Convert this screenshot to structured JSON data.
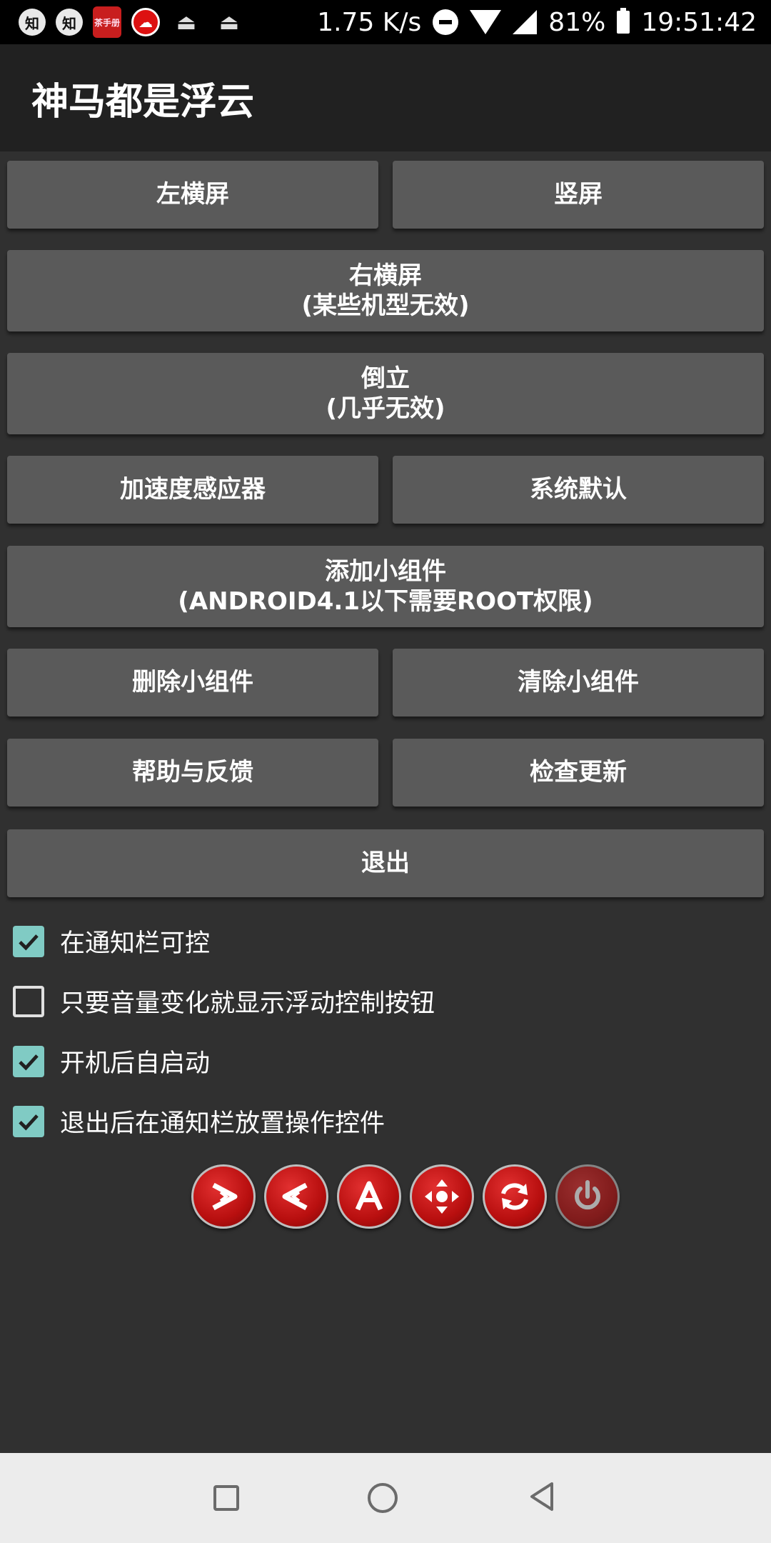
{
  "status_bar": {
    "icons": [
      "zhihu-icon",
      "zhihu-icon",
      "seal-app-icon",
      "cloud-icon",
      "upload-icon",
      "upload-icon"
    ],
    "zhihu1": "知",
    "zhihu2": "知",
    "seal": "茶手册",
    "speed": "1.75 K/s",
    "battery": "81%",
    "time": "19:51:42"
  },
  "app_bar": {
    "title": "神马都是浮云"
  },
  "buttons": {
    "left_landscape": "左横屏",
    "portrait": "竖屏",
    "right_landscape": "右横屏",
    "right_landscape_note": "(某些机型无效)",
    "upside_down": "倒立",
    "upside_down_note": "(几乎无效)",
    "accelerometer": "加速度感应器",
    "system_default": "系统默认",
    "add_widget": "添加小组件",
    "add_widget_note": "(ANDROID4.1以下需要ROOT权限)",
    "delete_widget": "删除小组件",
    "clear_widget": "清除小组件",
    "help_feedback": "帮助与反馈",
    "check_update": "检查更新",
    "exit": "退出"
  },
  "checkboxes": [
    {
      "label": "在通知栏可控",
      "checked": true
    },
    {
      "label": "只要音量变化就显示浮动控制按钮",
      "checked": false
    },
    {
      "label": "开机后自启动",
      "checked": true
    },
    {
      "label": "退出后在通知栏放置操作控件",
      "checked": true
    }
  ],
  "round_buttons": [
    "rotate-left-icon",
    "rotate-right-icon",
    "auto-rotate-icon",
    "move-icon",
    "refresh-icon",
    "power-icon"
  ],
  "colors": {
    "accent": "#80cbc4",
    "button_bg": "#5a5a5a",
    "app_bar_bg": "#212121",
    "body_bg": "#303030",
    "round_button": "#c41414"
  }
}
